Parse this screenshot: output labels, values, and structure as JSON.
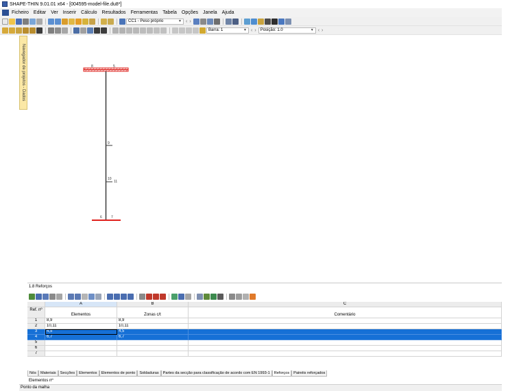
{
  "window": {
    "title": "SHAPE-THIN 9.01.01 x64 - [004595-model-file.du8*]"
  },
  "menu": [
    "Ficheiro",
    "Editar",
    "Ver",
    "Inserir",
    "Cálculo",
    "Resultados",
    "Ferramentas",
    "Tabela",
    "Opções",
    "Janela",
    "Ajuda"
  ],
  "toolbar1": {
    "loadcase": "CC1 - Peso próprio"
  },
  "toolbar2": {
    "barra_label": "Barra: 1",
    "posicao_label": "Posição: 1.0"
  },
  "navigator": {
    "label": "Navegador de projetos - Dados"
  },
  "drawing": {
    "node_labels": [
      "8",
      "5",
      "9",
      "10",
      "11",
      "6",
      "7"
    ],
    "colors": {
      "flange": "#e0201b",
      "web": "#3a3a3a",
      "hatch": "#c83a3a"
    }
  },
  "panel": {
    "title": "1.8 Reforços",
    "columns": {
      "rowhead": "Ref. nº",
      "A": "A",
      "B": "B",
      "C": "C",
      "A_label": "Elementos",
      "B_label": "Zonas c/t",
      "C_label": "Comentário"
    },
    "rows": [
      {
        "n": "1",
        "a": "8,9",
        "b": "8,9",
        "c": "",
        "selected": false
      },
      {
        "n": "2",
        "a": "10,11",
        "b": "10,11",
        "c": "",
        "selected": false
      },
      {
        "n": "3",
        "a": "4,5",
        "b": "4,5",
        "c": "",
        "selected": true
      },
      {
        "n": "4",
        "a": "6,7",
        "b": "6,7",
        "c": "",
        "selected": true
      },
      {
        "n": "5",
        "a": "",
        "b": "",
        "c": "",
        "selected": false
      },
      {
        "n": "6",
        "a": "",
        "b": "",
        "c": "",
        "selected": false
      },
      {
        "n": "7",
        "a": "",
        "b": "",
        "c": "",
        "selected": false
      }
    ],
    "tabs": [
      "Nós",
      "Materiais",
      "Secções",
      "Elementos",
      "Elementos de ponto",
      "Soldaduras",
      "Partes da secção para classificação de acordo com EN 1993-1",
      "Reforços",
      "Painéis reforçados"
    ],
    "active_tab": "Reforços",
    "status_line": "Elementos nº"
  },
  "statusbar": {
    "text": "Ponto da malha"
  }
}
